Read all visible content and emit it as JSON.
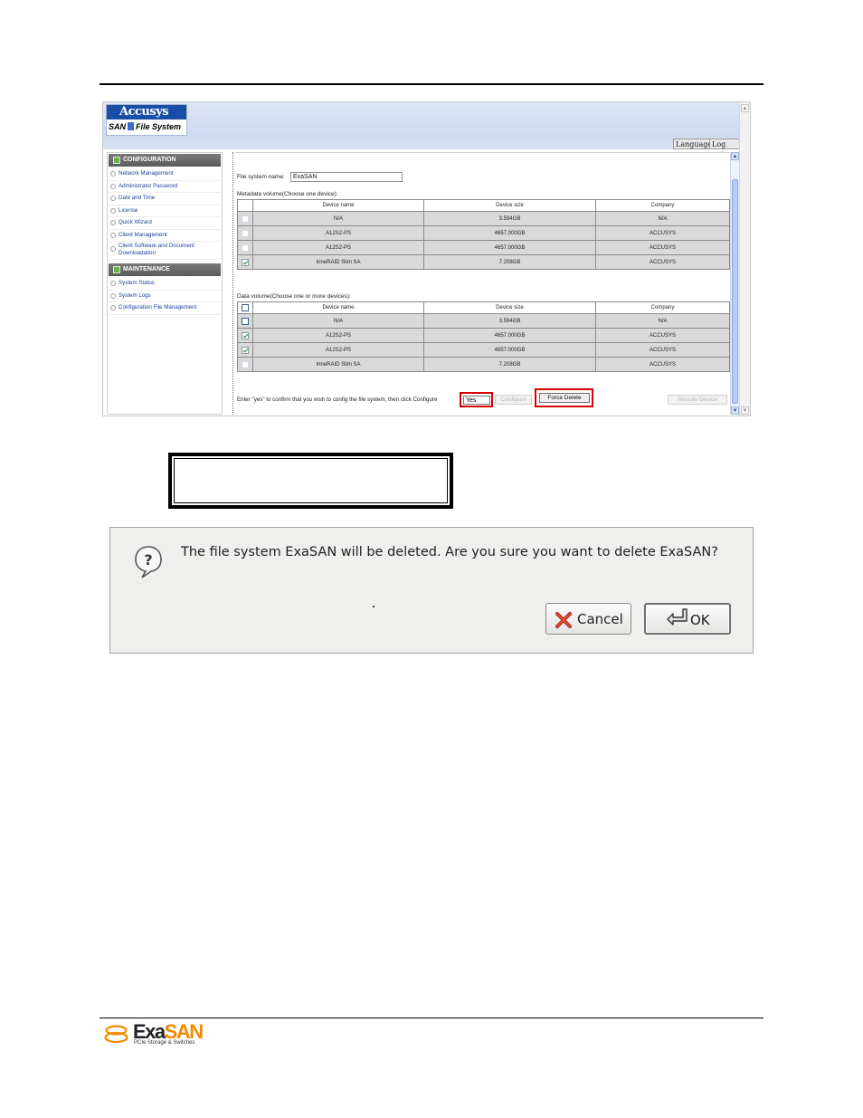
{
  "app": {
    "brand": "Accusys",
    "product": "SAN File System",
    "header_buttons": [
      "Language",
      "Log out"
    ]
  },
  "nav": {
    "sections": [
      {
        "title": "CONFIGURATION",
        "items": [
          "Network Management",
          "Administrator Password",
          "Date and Time",
          "License",
          "Quick Wizard",
          "Client Management",
          "Client Software and Document Downloadation"
        ]
      },
      {
        "title": "MAINTENANCE",
        "items": [
          "System Status",
          "System Logs",
          "Configuration File Management"
        ]
      }
    ]
  },
  "form": {
    "fs_name_label": "File system name:",
    "fs_name_value": "ExaSAN",
    "metadata": {
      "label": "Metadata volume(Choose one device):",
      "columns": [
        "Device name",
        "Device size",
        "Company"
      ],
      "rows": [
        {
          "name": "N/A",
          "size": "3.594GB",
          "company": "N/A",
          "checked": false
        },
        {
          "name": "A12S2-PS",
          "size": "4657.000GB",
          "company": "ACCUSYS",
          "checked": false
        },
        {
          "name": "A12S2-PS",
          "size": "4657.000GB",
          "company": "ACCUSYS",
          "checked": false
        },
        {
          "name": "InneRAID Slim SA",
          "size": "7.208GB",
          "company": "ACCUSYS",
          "checked": true
        }
      ]
    },
    "data": {
      "label": "Data volume(Choose one or more devices):",
      "columns": [
        "Device name",
        "Device size",
        "Company"
      ],
      "rows": [
        {
          "name": "N/A",
          "size": "3.594GB",
          "company": "N/A",
          "checked": false
        },
        {
          "name": "A12S2-PS",
          "size": "4657.000GB",
          "company": "ACCUSYS",
          "checked": true
        },
        {
          "name": "A12S2-PS",
          "size": "4657.000GB",
          "company": "ACCUSYS",
          "checked": true
        },
        {
          "name": "InneRAID Slim SA",
          "size": "7.208GB",
          "company": "ACCUSYS",
          "checked": false
        }
      ]
    },
    "confirm_text": "Enter \"yes\" to confirm that you wish to config the file system, then click Configure",
    "confirm_value": "Yes",
    "configure_label": "Configure",
    "force_delete_label": "Force Delete",
    "rescan_label": "Rescan Device"
  },
  "dialog": {
    "message": "The file system ExaSAN will be deleted. Are you sure you want to delete ExaSAN?",
    "cancel_label": "Cancel",
    "ok_label": "OK"
  },
  "footer": {
    "logo_exa": "Exa",
    "logo_san": "SAN",
    "tagline": "PCIe Storage & Switches"
  },
  "colors": {
    "highlight_red": "#d40000",
    "nav_link": "#1c3f94",
    "brand_blue": "#1a4ea6",
    "logo_orange": "#f28a00"
  }
}
